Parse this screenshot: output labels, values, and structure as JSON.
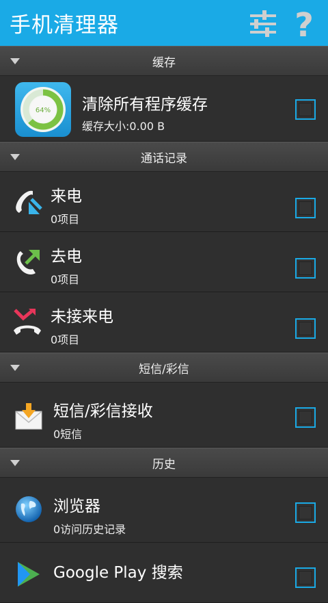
{
  "app": {
    "title": "手机清理器"
  },
  "toolbar": {
    "settings_icon": "settings-sliders-icon",
    "help_icon": "help-question-icon"
  },
  "sections": {
    "cache": {
      "label": "缓存"
    },
    "calls": {
      "label": "通话记录"
    },
    "sms": {
      "label": "短信/彩信"
    },
    "history": {
      "label": "历史"
    }
  },
  "cache": {
    "item": {
      "title": "清除所有程序缓存",
      "sub": "缓存大小:0.00 B",
      "gauge_percent": 64,
      "gauge_label": "64%"
    }
  },
  "calls": {
    "incoming": {
      "title": "来电",
      "sub": "0项目"
    },
    "outgoing": {
      "title": "去电",
      "sub": "0项目"
    },
    "missed": {
      "title": "未接来电",
      "sub": "0项目"
    }
  },
  "sms": {
    "inbox": {
      "title": "短信/彩信接收",
      "sub": "0短信"
    }
  },
  "history": {
    "browser": {
      "title": "浏览器",
      "sub": "0访问历史记录"
    },
    "play": {
      "title": "Google Play 搜索"
    }
  },
  "colors": {
    "accent": "#1aaae6",
    "bg": "#2b2b2b"
  }
}
